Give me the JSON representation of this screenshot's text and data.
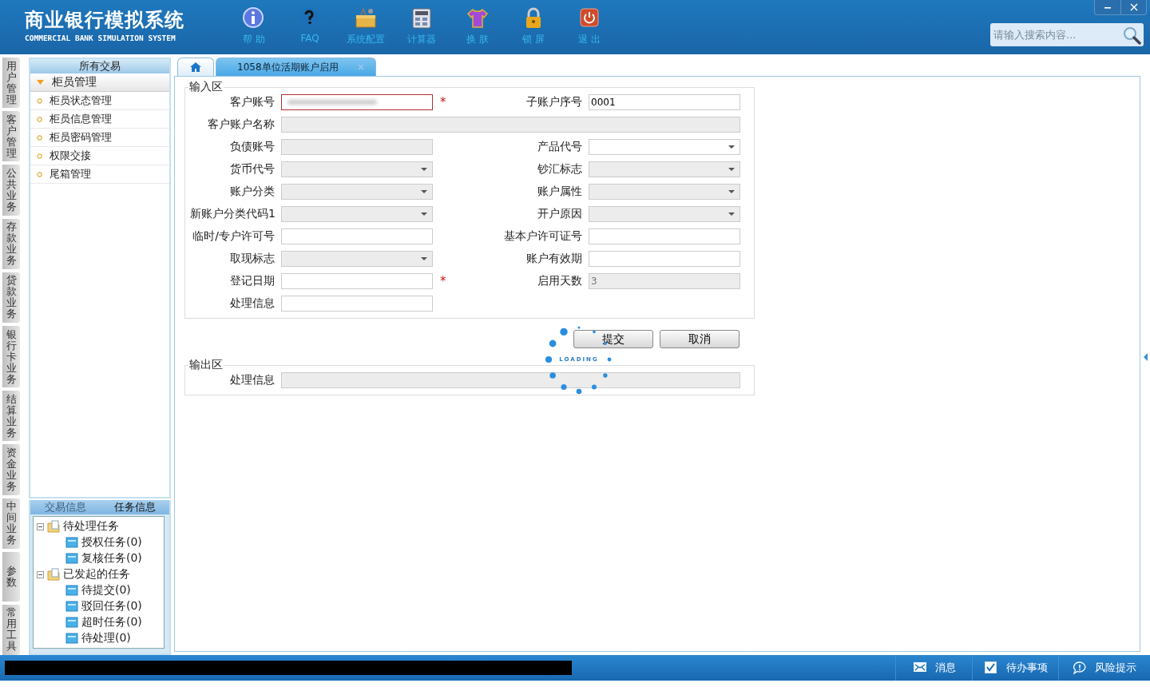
{
  "app": {
    "title": "商业银行模拟系统",
    "subtitle": "COMMERCIAL BANK SIMULATION SYSTEM"
  },
  "toolbar": [
    {
      "kind": "info",
      "label": "帮 助"
    },
    {
      "kind": "faq",
      "label": "FAQ"
    },
    {
      "kind": "config",
      "label": "系统配置"
    },
    {
      "kind": "calculator",
      "label": "计算器"
    },
    {
      "kind": "skin",
      "label": "换 肤"
    },
    {
      "kind": "lock",
      "label": "锁 屏"
    },
    {
      "kind": "exit",
      "label": "退 出"
    }
  ],
  "search": {
    "placeholder": "请输入搜索内容..."
  },
  "side_tabs": [
    {
      "label": "用户管理"
    },
    {
      "label": "客户管理"
    },
    {
      "label": "公共业务"
    },
    {
      "label": "存款业务"
    },
    {
      "label": "贷款业务"
    },
    {
      "label": "银行卡业务"
    },
    {
      "label": "结算业务"
    },
    {
      "label": "资金业务"
    },
    {
      "label": "中间业务"
    },
    {
      "label": "参数"
    },
    {
      "label": "常用工具"
    }
  ],
  "sidebar": {
    "title": "所有交易",
    "group": {
      "label": "柜员管理",
      "expanded": true,
      "items": [
        {
          "label": "柜员状态管理"
        },
        {
          "label": "柜员信息管理"
        },
        {
          "label": "柜员密码管理"
        },
        {
          "label": "权限交接"
        },
        {
          "label": "尾箱管理"
        }
      ]
    },
    "info_tabs": [
      {
        "label": "交易信息",
        "selected": false
      },
      {
        "label": "任务信息",
        "selected": true
      }
    ],
    "tree": [
      {
        "label": "待处理任务",
        "expanded": true,
        "children": [
          {
            "label": "授权任务(0)"
          },
          {
            "label": "复核任务(0)"
          }
        ]
      },
      {
        "label": "已发起的任务",
        "expanded": true,
        "children": [
          {
            "label": "待提交(0)"
          },
          {
            "label": "驳回任务(0)"
          },
          {
            "label": "超时任务(0)"
          },
          {
            "label": "待处理(0)"
          }
        ]
      }
    ]
  },
  "tabs": [
    {
      "kind": "home",
      "selected": false
    },
    {
      "kind": "page",
      "label": "1058单位活期账户启用",
      "selected": true
    }
  ],
  "input_area": {
    "title": "输入区",
    "rows": [
      [
        {
          "label": "客户账号",
          "kind": "text",
          "disabled": false,
          "invalid": true,
          "value_hidden": true,
          "required_mark": "*"
        },
        {
          "label": "子账户序号",
          "kind": "text",
          "disabled": false,
          "value": "0001"
        }
      ],
      [
        {
          "label": "客户账户名称",
          "kind": "text",
          "disabled": true,
          "wide": true
        }
      ],
      [
        {
          "label": "负债账号",
          "kind": "text",
          "disabled": true
        },
        {
          "label": "产品代号",
          "kind": "select",
          "disabled": false
        }
      ],
      [
        {
          "label": "货币代号",
          "kind": "select",
          "disabled": true
        },
        {
          "label": "钞汇标志",
          "kind": "select",
          "disabled": true
        }
      ],
      [
        {
          "label": "账户分类",
          "kind": "select",
          "disabled": true
        },
        {
          "label": "账户属性",
          "kind": "select",
          "disabled": true
        }
      ],
      [
        {
          "label": "新账户分类代码1",
          "kind": "select",
          "disabled": true
        },
        {
          "label": "开户原因",
          "kind": "select",
          "disabled": true
        }
      ],
      [
        {
          "label": "临时/专户许可号",
          "kind": "text",
          "disabled": false
        },
        {
          "label": "基本户许可证号",
          "kind": "text",
          "disabled": false
        }
      ],
      [
        {
          "label": "取现标志",
          "kind": "select",
          "disabled": true
        },
        {
          "label": "账户有效期",
          "kind": "text",
          "disabled": false
        }
      ],
      [
        {
          "label": "登记日期",
          "kind": "text",
          "disabled": false,
          "required_mark": "*"
        },
        {
          "label": "启用天数",
          "kind": "text",
          "disabled": true,
          "value": "3"
        }
      ],
      [
        {
          "label": "处理信息",
          "kind": "text",
          "disabled": false
        }
      ]
    ]
  },
  "buttons": [
    {
      "label": "提交"
    },
    {
      "label": "取消"
    }
  ],
  "loading": {
    "text": "LOADING"
  },
  "output_area": {
    "title": "输出区",
    "rows": [
      [
        {
          "label": "处理信息",
          "kind": "text",
          "disabled": true,
          "wide": true
        }
      ]
    ]
  },
  "status_bar": [
    {
      "kind": "mail",
      "label": "消息"
    },
    {
      "kind": "check",
      "label": "待办事项"
    },
    {
      "kind": "chat",
      "label": "风险提示"
    }
  ]
}
